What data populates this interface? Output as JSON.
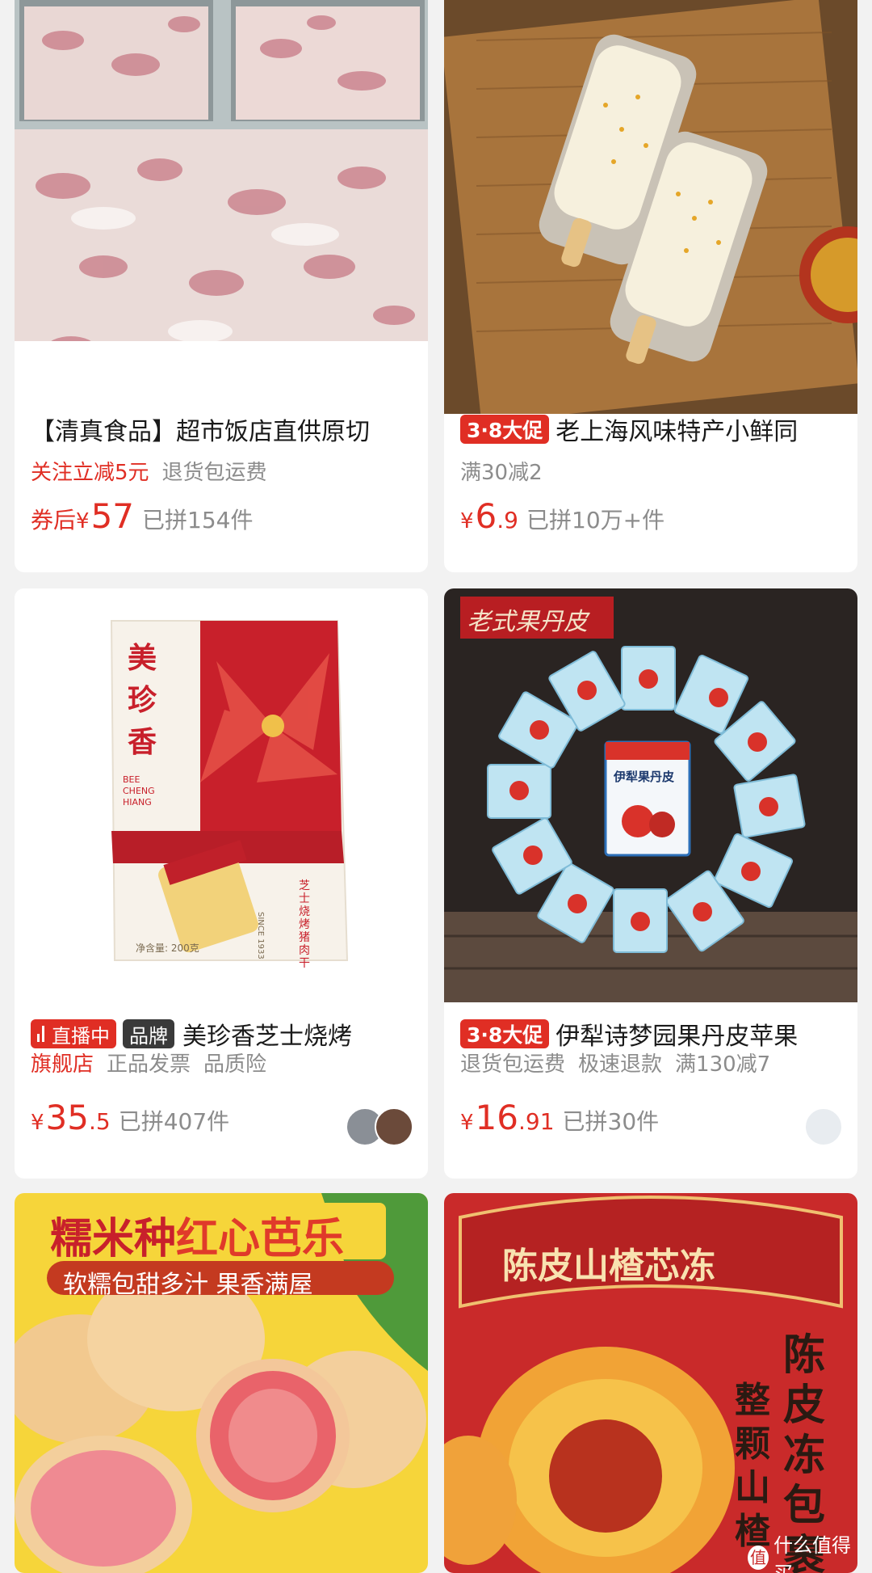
{
  "products": [
    {
      "title": "【清真食品】超市饭店直供原切",
      "tags": [
        "关注立减5元",
        "退货包运费"
      ],
      "price_prefix": "券后",
      "price_yen": "¥",
      "price_int": "57",
      "price_dec": "",
      "sold": "已拼154件"
    },
    {
      "badge": "3·8大促",
      "title": "老上海风味特产小鲜同",
      "tags": [
        "满30减2"
      ],
      "price_yen": "¥",
      "price_int": "6",
      "price_dec": ".9",
      "sold": "已拼10万+件"
    },
    {
      "live_badge": "直播中",
      "brand_badge": "品牌",
      "title": "美珍香芝士烧烤",
      "tags": [
        "旗舰店",
        "正品发票",
        "品质险"
      ],
      "price_yen": "¥",
      "price_int": "35",
      "price_dec": ".5",
      "sold": "已拼407件",
      "image_text": {
        "brand_cn": "美珍香",
        "brand_en": "BEE CHENG HIANG",
        "label": "芝士烧烤猪肉干",
        "since": "SINCE 1933",
        "weight": "净含量: 200克"
      }
    },
    {
      "badge": "3·8大促",
      "title": "伊犁诗梦园果丹皮苹果",
      "tags": [
        "退货包运费",
        "极速退款",
        "满130减7"
      ],
      "price_yen": "¥",
      "price_int": "16",
      "price_dec": ".91",
      "sold": "已拼30件",
      "image_text": {
        "banner": "老式果丹皮",
        "box": "伊犁果丹皮"
      }
    },
    {
      "image_text": {
        "headline_a": "糯米种",
        "headline_b": "红心芭乐",
        "sub": "软糯包甜多汁 果香满屋"
      }
    },
    {
      "image_text": {
        "headline": "陈皮山楂芯冻",
        "vertical_a": "陈皮冻包裹",
        "vertical_b": "整颗山楂"
      }
    }
  ],
  "watermark": "什么值得买",
  "colors": {
    "accent": "#e02e24",
    "muted": "#8c8c8c",
    "background": "#f2f2f2"
  }
}
